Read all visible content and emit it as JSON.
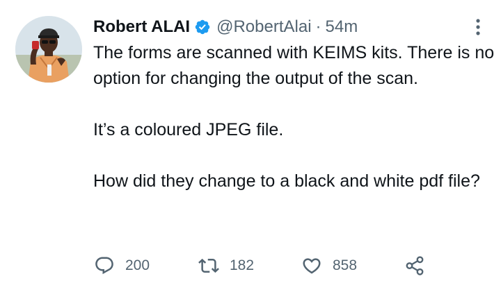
{
  "tweet": {
    "author": {
      "display_name": "Robert ALAI",
      "handle": "@RobertAlai",
      "verified": true,
      "separator": "·",
      "time": "54m"
    },
    "paragraphs": [
      "The forms are scanned with KEIMS kits. There is no option for changing the output of the scan.",
      "It’s a coloured JPEG file.",
      "How did they change to a black and white pdf file?"
    ],
    "actions": {
      "reply_count": "200",
      "retweet_count": "182",
      "like_count": "858"
    },
    "icons": {
      "verified": "verified-badge-icon",
      "more": "more-options-icon",
      "reply": "reply-icon",
      "retweet": "retweet-icon",
      "like": "heart-icon",
      "share": "share-icon"
    },
    "colors": {
      "text": "#0f1419",
      "secondary": "#536471",
      "verified_blue": "#1d9bf0",
      "background": "#ffffff"
    }
  }
}
